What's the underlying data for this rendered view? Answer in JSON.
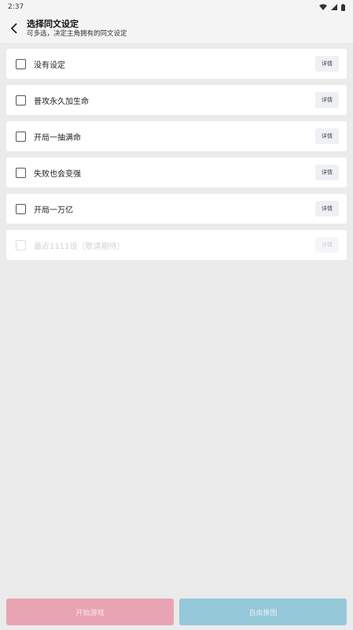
{
  "status_bar": {
    "time": "2:37"
  },
  "header": {
    "title": "选择同文设定",
    "subtitle": "可多选，决定主角拥有的同文设定"
  },
  "items": [
    {
      "label": "没有设定",
      "detail_label": "详情",
      "enabled": true
    },
    {
      "label": "普攻永久加生命",
      "detail_label": "详情",
      "enabled": true
    },
    {
      "label": "开局一抽满命",
      "detail_label": "详情",
      "enabled": true
    },
    {
      "label": "失败也会变强",
      "detail_label": "详情",
      "enabled": true
    },
    {
      "label": "开局一万亿",
      "detail_label": "详情",
      "enabled": true
    },
    {
      "label": "最近1111设（敬请期待）",
      "detail_label": "详情",
      "enabled": false
    }
  ],
  "footer": {
    "start_label": "开始游戏",
    "free_label": "自由推图"
  },
  "colors": {
    "start_button": "#e9a4b3",
    "free_button": "#95c8d8",
    "background": "#ebebeb"
  }
}
